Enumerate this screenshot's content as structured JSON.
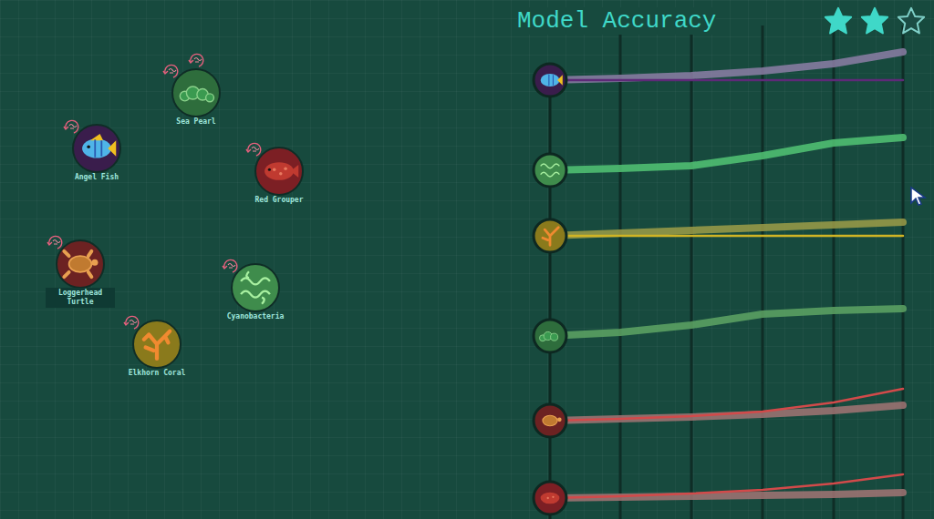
{
  "canvas": {
    "nodes": [
      {
        "name": "Sea Pearl",
        "color": "#2e6d3c",
        "badges": 2,
        "selected": false
      },
      {
        "name": "Angel Fish",
        "color": "#3a1d4c",
        "badges": 1,
        "selected": false
      },
      {
        "name": "Red Grouper",
        "color": "#7c1f24",
        "badges": 1,
        "selected": false
      },
      {
        "name": "Loggerhead Turtle",
        "color": "#6c2222",
        "badges": 1,
        "selected": true
      },
      {
        "name": "Cyanobacteria",
        "color": "#3f8c4c",
        "badges": 1,
        "selected": false
      },
      {
        "name": "Elkhorn Coral",
        "color": "#8a7a1c",
        "badges": 1,
        "selected": false
      }
    ]
  },
  "chart": {
    "title": "Model Accuracy",
    "stars": 2,
    "starsTotal": 3,
    "rows": [
      {
        "fill": "#3a1d4c",
        "color": "#8c7ea6",
        "actualColor": "#5e2a78",
        "model": [
          0,
          2,
          5,
          10,
          18,
          31
        ],
        "actual": [
          0,
          0,
          0,
          0,
          0,
          0
        ]
      },
      {
        "fill": "#3f8c4c",
        "color": "#52c474",
        "actualColor": "#52c474",
        "model": [
          0,
          2,
          5,
          16,
          30,
          36
        ],
        "actual": []
      },
      {
        "fill": "#8a7a1c",
        "color": "#9c9c48",
        "actualColor": "#d0b424",
        "model": [
          0,
          3,
          6,
          9,
          12,
          15
        ],
        "actual": [
          0,
          0,
          0,
          0,
          0,
          0
        ]
      },
      {
        "fill": "#2e6d3c",
        "color": "#5ea464",
        "actualColor": "#5ea464",
        "model": [
          0,
          4,
          12,
          24,
          28,
          30
        ],
        "actual": []
      },
      {
        "fill": "#6c2222",
        "color": "#a27474",
        "actualColor": "#d24a4a",
        "model": [
          0,
          2,
          4,
          7,
          11,
          17
        ],
        "actual": [
          0,
          2,
          5,
          10,
          20,
          35
        ]
      },
      {
        "fill": "#7c1f24",
        "color": "#a27474",
        "actualColor": "#d24a4a",
        "model": [
          0,
          1,
          2,
          3,
          4,
          6
        ],
        "actual": [
          0,
          2,
          5,
          9,
          16,
          26
        ]
      }
    ]
  }
}
